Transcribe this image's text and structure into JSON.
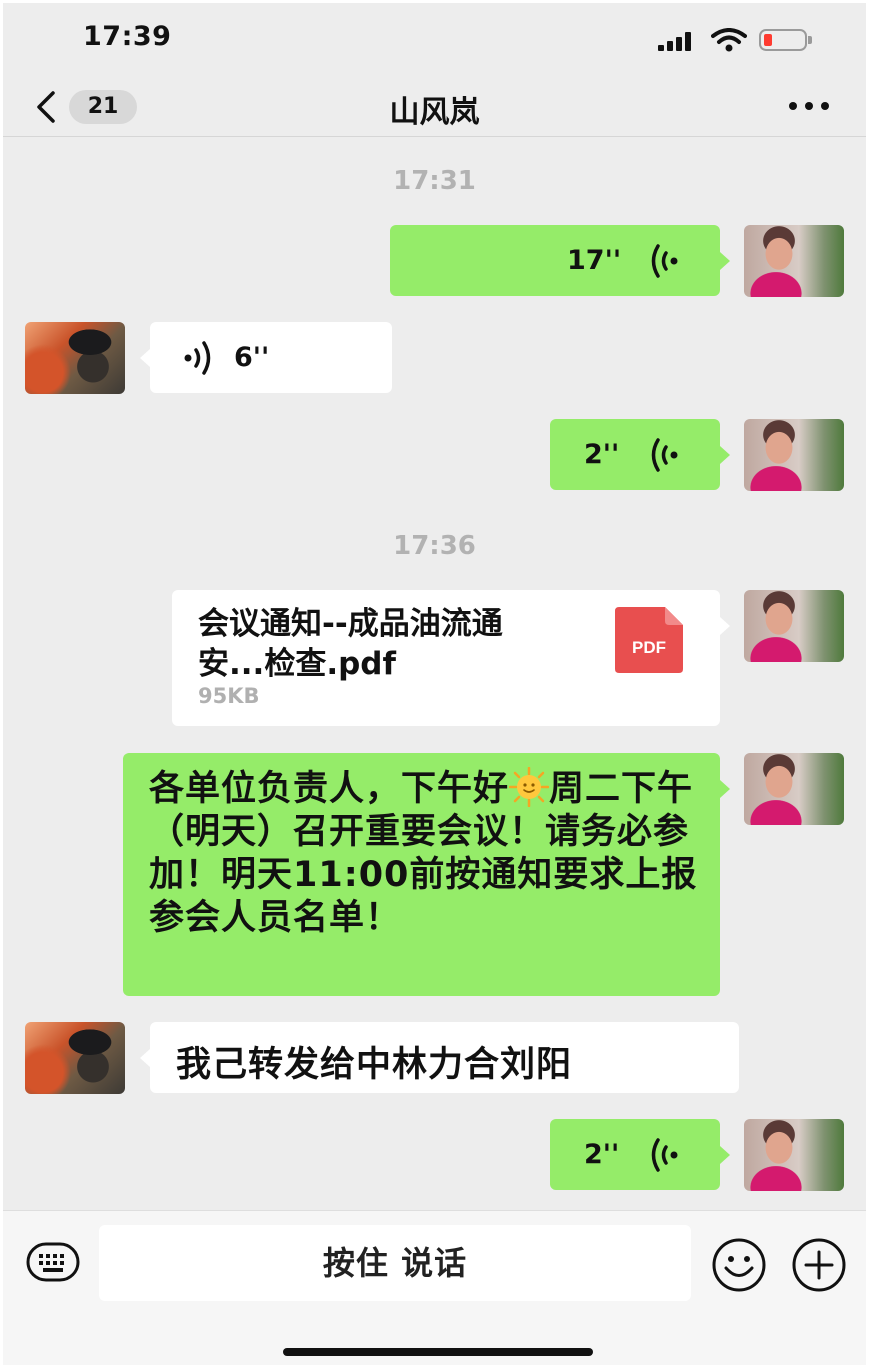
{
  "status_bar": {
    "time": "17:39"
  },
  "nav": {
    "unread_count": "21",
    "title": "山风岚"
  },
  "messages": {
    "time_1": "17:31",
    "voice_1_duration": "17''",
    "voice_2_duration": "6''",
    "voice_3_duration": "2''",
    "time_2": "17:36",
    "file": {
      "name": "会议通知--成品油流通安...检查.pdf",
      "size": "95KB",
      "type_label": "PDF"
    },
    "notice_text_before_emoji": "各单位负责人，下午好",
    "notice_text_after_emoji": "周二下午（明天）召开重要会议！请务必参加！明天11:00前按通知要求上报参会人员名单！",
    "reply_text": "我己转发给中林力合刘阳",
    "voice_4_duration": "2''"
  },
  "input_bar": {
    "talk_label": "按住 说话"
  },
  "colors": {
    "self_bubble": "#95ec69",
    "other_bubble": "#ffffff",
    "chat_background": "#ededed",
    "pdf_red": "#e84f4f",
    "battery_low": "#ff3b30"
  },
  "icons": {
    "back": "chevron-left",
    "more": "ellipsis",
    "voice": "sound-waves",
    "keyboard": "keyboard",
    "emoji": "smiley-face",
    "plus": "plus-circle",
    "sun_emoji": "sun-with-face"
  }
}
